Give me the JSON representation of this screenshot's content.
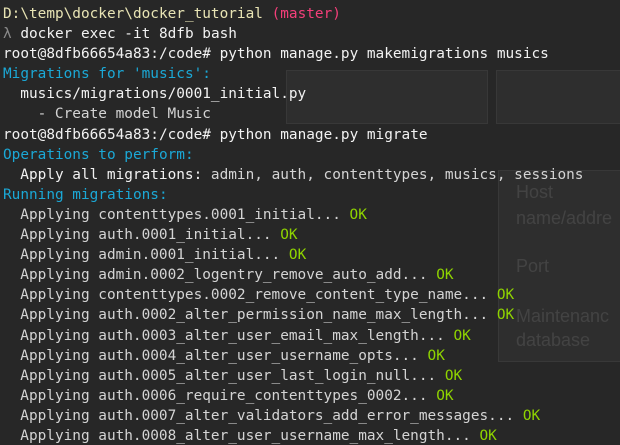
{
  "window": {
    "colors": {
      "background": "#272727",
      "path": "#e8e4b4",
      "branch": "#f43f7a",
      "cyan": "#1ba8d6",
      "ok": "#8fd400",
      "text": "#dcdcdc"
    }
  },
  "prompt_line": {
    "path": "D:\\temp\\docker\\docker_tutorial",
    "branch": "(master)"
  },
  "command_1": {
    "symbol": "λ",
    "text": "docker exec -it 8dfb bash"
  },
  "command_2": {
    "prompt": "root@8dfb66654a83:/code#",
    "text": "python manage.py makemigrations musics"
  },
  "makemigrations_output": {
    "header": "Migrations for 'musics':",
    "file": "musics/migrations/0001_initial.py",
    "action": "- Create model Music"
  },
  "command_3": {
    "prompt": "root@8dfb66654a83:/code#",
    "text": "python manage.py migrate"
  },
  "migrate_output": {
    "operations_header": "Operations to perform:",
    "apply_label": "Apply all migrations:",
    "apply_apps": "admin, auth, contenttypes, musics, sessions",
    "running_header": "Running migrations:",
    "applying_word": "Applying",
    "ok_word": "OK",
    "migrations": [
      "contenttypes.0001_initial...",
      "auth.0001_initial...",
      "admin.0001_initial...",
      "admin.0002_logentry_remove_auto_add...",
      "contenttypes.0002_remove_content_type_name...",
      "auth.0002_alter_permission_name_max_length...",
      "auth.0003_alter_user_email_max_length...",
      "auth.0004_alter_user_username_opts...",
      "auth.0005_alter_user_last_login_null...",
      "auth.0006_require_contenttypes_0002...",
      "auth.0007_alter_validators_add_error_messages...",
      "auth.0008_alter_user_username_max_length..."
    ]
  }
}
